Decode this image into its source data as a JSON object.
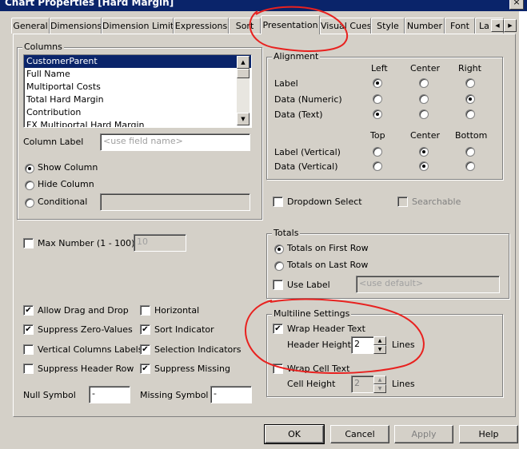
{
  "window": {
    "title": "Chart Properties [Hard Margin]",
    "close_glyph": "×"
  },
  "tabs": [
    "General",
    "Dimensions",
    "Dimension Limits",
    "Expressions",
    "Sort",
    "Presentation",
    "Visual Cues",
    "Style",
    "Number",
    "Font",
    "La"
  ],
  "tab_scroll": {
    "left": "◀",
    "right": "▶"
  },
  "columns": {
    "legend": "Columns",
    "items": [
      "CustomerParent",
      "Full Name",
      "Multiportal Costs",
      "Total Hard Margin",
      "Contribution",
      "FX Multiportal Hard Margin"
    ],
    "column_label": "Column Label",
    "column_label_placeholder": "<use field name>",
    "show_column": "Show Column",
    "hide_column": "Hide Column",
    "conditional": "Conditional"
  },
  "alignment": {
    "legend": "Alignment",
    "col_left": "Left",
    "col_center": "Center",
    "col_right": "Right",
    "label": "Label",
    "data_numeric": "Data (Numeric)",
    "data_text": "Data (Text)",
    "col_top": "Top",
    "col_center2": "Center",
    "col_bottom": "Bottom",
    "label_vertical": "Label (Vertical)",
    "data_vertical": "Data (Vertical)"
  },
  "dropdown_select": "Dropdown Select",
  "searchable": "Searchable",
  "max_number": {
    "label": "Max Number (1 - 100)",
    "value": "10"
  },
  "options": {
    "allow_drag": "Allow Drag and Drop",
    "suppress_zero": "Suppress Zero-Values",
    "vertical_labels": "Vertical Columns Labels",
    "suppress_header": "Suppress Header Row",
    "horizontal": "Horizontal",
    "sort_indicator": "Sort Indicator",
    "selection_indicators": "Selection Indicators",
    "suppress_missing": "Suppress Missing"
  },
  "null_symbol": {
    "label": "Null Symbol",
    "value": "-"
  },
  "missing_symbol": {
    "label": "Missing Symbol",
    "value": "-"
  },
  "totals": {
    "legend": "Totals",
    "first_row": "Totals on First Row",
    "last_row": "Totals on Last Row",
    "use_label": "Use Label",
    "label_placeholder": "<use default>"
  },
  "multiline": {
    "legend": "Multiline Settings",
    "wrap_header": "Wrap Header Text",
    "header_height": "Header Height",
    "header_height_value": "2",
    "header_lines": "Lines",
    "wrap_cell": "Wrap Cell Text",
    "cell_height": "Cell Height",
    "cell_height_value": "2",
    "cell_lines": "Lines"
  },
  "buttons": {
    "ok": "OK",
    "cancel": "Cancel",
    "apply": "Apply",
    "help": "Help"
  },
  "check_glyph": "✔",
  "annotation_color": "#e8211f"
}
